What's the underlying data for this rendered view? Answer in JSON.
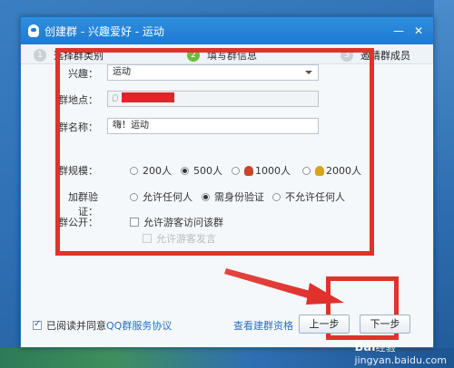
{
  "window": {
    "title": "创建群 - 兴趣爱好 - 运动",
    "minimize_icon": "minimize-icon",
    "close_icon": "close-icon"
  },
  "steps": [
    {
      "num": "1",
      "label": "选择群类别",
      "active": false
    },
    {
      "num": "2",
      "label": "填写群信息",
      "active": true
    },
    {
      "num": "3",
      "label": "邀请群成员",
      "active": false
    }
  ],
  "form": {
    "interest_label": "兴趣：",
    "interest_value": "运动",
    "location_label": "群地点：",
    "name_label": "群名称：",
    "name_value": "嗨！运动",
    "size_label": "群规模：",
    "size_options": [
      "200人",
      "500人",
      "1000人",
      "2000人"
    ],
    "size_selected": "500人",
    "verify_label": "加群验证：",
    "verify_options": [
      "允许任何人",
      "需身份验证",
      "不允许任何人"
    ],
    "verify_selected": "需身份验证",
    "public_label": "群公开：",
    "public_option": "允许游客访问该群",
    "public_sub_option": "允许游客发言"
  },
  "footer": {
    "agree_text": "已阅读并同意",
    "agree_link": "QQ群服务协议",
    "qualification_link": "查看建群资格",
    "prev_button": "上一步",
    "next_button": "下一步"
  },
  "watermark": {
    "brand": "Bai",
    "brand_suffix": "经验",
    "url": "jingyan.baidu.com"
  },
  "colors": {
    "highlight": "#e0322c",
    "titlebar": "#1f7ad1",
    "link": "#2b6fc1",
    "active_step": "#6ebd3d"
  }
}
